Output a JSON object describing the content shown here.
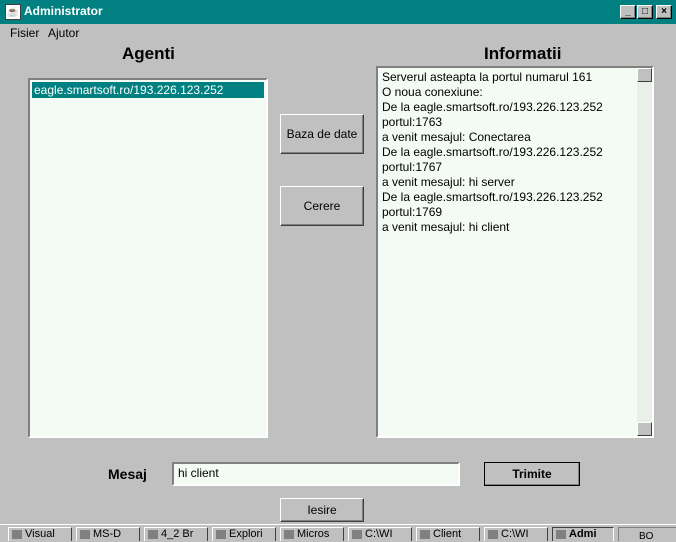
{
  "window": {
    "title": "Administrator",
    "icon": "java-cup-icon",
    "controls": {
      "minimize": "_",
      "maximize": "□",
      "close": "×"
    }
  },
  "menu": {
    "items": [
      "Fisier",
      "Ajutor"
    ]
  },
  "agents": {
    "heading": "Agenti",
    "items": [
      "eagle.smartsoft.ro/193.226.123.252"
    ],
    "selected_index": 0
  },
  "info": {
    "heading": "Informatii",
    "text": "Serverul asteapta la portul numarul 161\nO noua conexiune:\nDe la eagle.smartsoft.ro/193.226.123.252\nportul:1763\na venit mesajul: Conectarea\nDe la eagle.smartsoft.ro/193.226.123.252\nportul:1767\na venit mesajul: hi server\nDe la eagle.smartsoft.ro/193.226.123.252\nportul:1769\na venit mesajul: hi client"
  },
  "buttons": {
    "baza": "Baza de date",
    "cerere": "Cerere",
    "trimite": "Trimite",
    "iesire": "Iesire"
  },
  "message": {
    "label": "Mesaj",
    "value": "hi client"
  },
  "taskbar": {
    "tasks": [
      {
        "label": "Visual",
        "icon": "visual-icon"
      },
      {
        "label": "MS-D",
        "icon": "msdos-icon"
      },
      {
        "label": "4_2 Br",
        "icon": "folder-icon"
      },
      {
        "label": "Explori",
        "icon": "explorer-icon"
      },
      {
        "label": "Micros",
        "icon": "word-icon"
      },
      {
        "label": "C:\\WI",
        "icon": "msdos-icon"
      },
      {
        "label": "Client",
        "icon": "java-cup-icon"
      },
      {
        "label": "C:\\WI",
        "icon": "msdos-icon"
      },
      {
        "label": "Admi",
        "icon": "java-cup-icon",
        "active": true
      }
    ],
    "tray_text": "BO"
  }
}
